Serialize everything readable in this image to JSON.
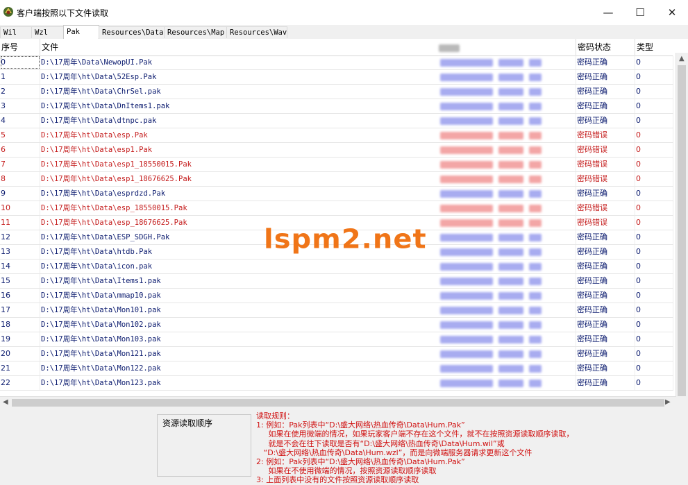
{
  "window": {
    "title": "客户端按照以下文件读取",
    "minimize": "—",
    "maximize": "☐",
    "close": "✕"
  },
  "tabs": [
    {
      "label": "Wil"
    },
    {
      "label": "Wzl"
    },
    {
      "label": "Pak",
      "active": true
    },
    {
      "label": "Resources\\Data"
    },
    {
      "label": "Resources\\Map"
    },
    {
      "label": "Resources\\Wav"
    }
  ],
  "columns": {
    "index": "序号",
    "file": "文件",
    "password_status": "密码状态",
    "type": "类型"
  },
  "rows": [
    {
      "index": "0",
      "file": "D:\\17周年\\Data\\NewopUI.Pak",
      "status": "密码正确",
      "type": "0",
      "ok": true
    },
    {
      "index": "1",
      "file": "D:\\17周年\\ht\\Data\\52Esp.Pak",
      "status": "密码正确",
      "type": "0",
      "ok": true
    },
    {
      "index": "2",
      "file": "D:\\17周年\\ht\\Data\\ChrSel.pak",
      "status": "密码正确",
      "type": "0",
      "ok": true
    },
    {
      "index": "3",
      "file": "D:\\17周年\\ht\\Data\\DnItems1.pak",
      "status": "密码正确",
      "type": "0",
      "ok": true
    },
    {
      "index": "4",
      "file": "D:\\17周年\\ht\\Data\\dtnpc.pak",
      "status": "密码正确",
      "type": "0",
      "ok": true
    },
    {
      "index": "5",
      "file": "D:\\17周年\\ht\\Data\\esp.Pak",
      "status": "密码错误",
      "type": "0",
      "ok": false
    },
    {
      "index": "6",
      "file": "D:\\17周年\\ht\\Data\\esp1.Pak",
      "status": "密码错误",
      "type": "0",
      "ok": false
    },
    {
      "index": "7",
      "file": "D:\\17周年\\ht\\Data\\esp1_18550015.Pak",
      "status": "密码错误",
      "type": "0",
      "ok": false
    },
    {
      "index": "8",
      "file": "D:\\17周年\\ht\\Data\\esp1_18676625.Pak",
      "status": "密码错误",
      "type": "0",
      "ok": false
    },
    {
      "index": "9",
      "file": "D:\\17周年\\ht\\Data\\esprdzd.Pak",
      "status": "密码正确",
      "type": "0",
      "ok": true
    },
    {
      "index": "10",
      "file": "D:\\17周年\\ht\\Data\\esp_18550015.Pak",
      "status": "密码错误",
      "type": "0",
      "ok": false
    },
    {
      "index": "11",
      "file": "D:\\17周年\\ht\\Data\\esp_18676625.Pak",
      "status": "密码错误",
      "type": "0",
      "ok": false
    },
    {
      "index": "12",
      "file": "D:\\17周年\\ht\\Data\\ESP_SDGH.Pak",
      "status": "密码正确",
      "type": "0",
      "ok": true
    },
    {
      "index": "13",
      "file": "D:\\17周年\\ht\\Data\\htdb.Pak",
      "status": "密码正确",
      "type": "0",
      "ok": true
    },
    {
      "index": "14",
      "file": "D:\\17周年\\ht\\Data\\icon.pak",
      "status": "密码正确",
      "type": "0",
      "ok": true
    },
    {
      "index": "15",
      "file": "D:\\17周年\\ht\\Data\\Items1.pak",
      "status": "密码正确",
      "type": "0",
      "ok": true
    },
    {
      "index": "16",
      "file": "D:\\17周年\\ht\\Data\\mmap10.pak",
      "status": "密码正确",
      "type": "0",
      "ok": true
    },
    {
      "index": "17",
      "file": "D:\\17周年\\ht\\Data\\Mon101.pak",
      "status": "密码正确",
      "type": "0",
      "ok": true
    },
    {
      "index": "18",
      "file": "D:\\17周年\\ht\\Data\\Mon102.pak",
      "status": "密码正确",
      "type": "0",
      "ok": true
    },
    {
      "index": "19",
      "file": "D:\\17周年\\ht\\Data\\Mon103.pak",
      "status": "密码正确",
      "type": "0",
      "ok": true
    },
    {
      "index": "20",
      "file": "D:\\17周年\\ht\\Data\\Mon121.pak",
      "status": "密码正确",
      "type": "0",
      "ok": true
    },
    {
      "index": "21",
      "file": "D:\\17周年\\ht\\Data\\Mon122.pak",
      "status": "密码正确",
      "type": "0",
      "ok": true
    },
    {
      "index": "22",
      "file": "D:\\17周年\\ht\\Data\\Mon123.pak",
      "status": "密码正确",
      "type": "0",
      "ok": true
    }
  ],
  "read_order_group": {
    "title": "资源读取顺序"
  },
  "rules_text": "读取规则：\n1: 例如：Pak列表中“D:\\盛大网络\\热血传奇\\Data\\Hum.Pak”\n     如果在使用微端的情况，如果玩家客户端不存在这个文件，就不在按照资源读取顺序读取，\n     就是不会在往下读取是否有“D:\\盛大网络\\热血传奇\\Data\\Hum.wil”或\n   “D:\\盛大网络\\热血传奇\\Data\\Hum.wzl”，而是向微端服务器请求更新这个文件\n2: 例如：Pak列表中“D:\\盛大网络\\热血传奇\\Data\\Hum.Pak”\n     如果在不使用微端的情况，按照资源读取顺序读取\n3: 上面列表中没有的文件按照资源读取顺序读取",
  "watermark": "lspm2.net",
  "colors": {
    "ok_text": "#0a1a6e",
    "error_text": "#c41a1a",
    "rules_text": "#d01010",
    "watermark": "#f07518"
  }
}
